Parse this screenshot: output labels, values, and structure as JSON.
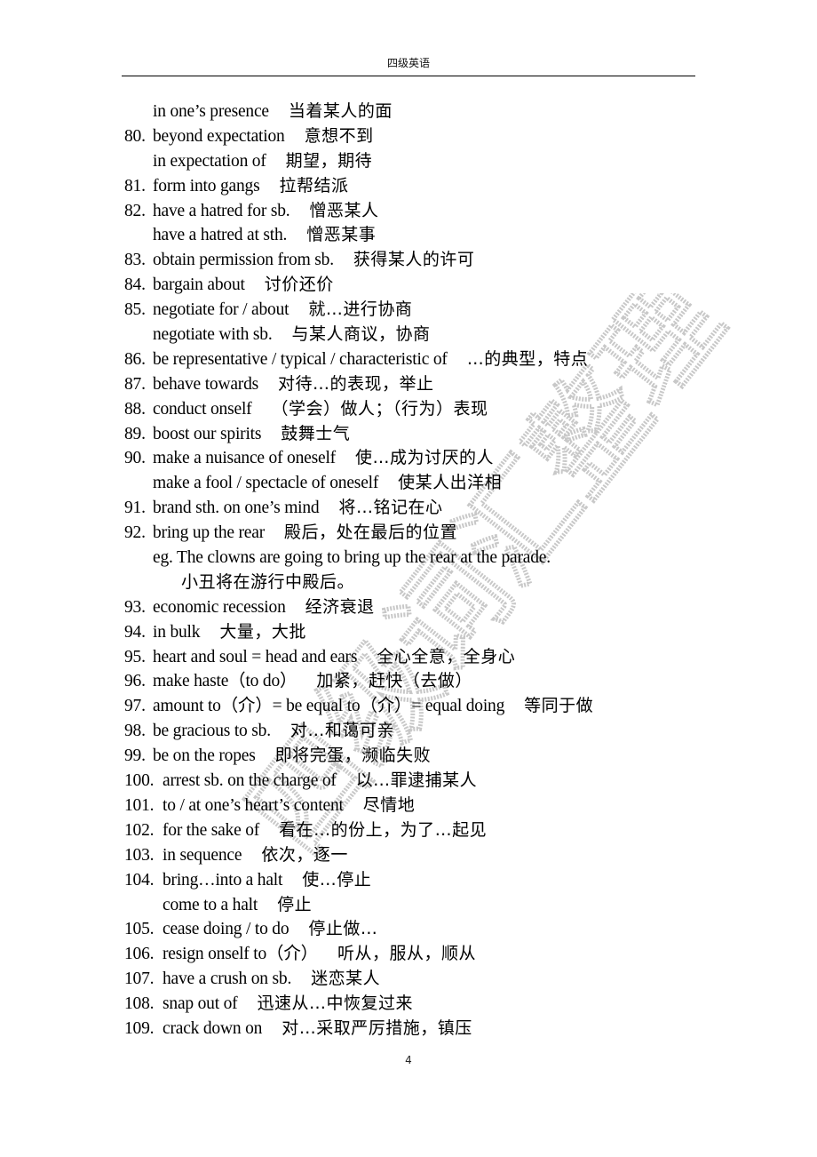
{
  "header": {
    "title": "四级英语"
  },
  "watermark": {
    "text": "四级词汇整理"
  },
  "entries": [
    {
      "num": "",
      "en": "in one’s presence",
      "zh": "当着某人的面",
      "level": "sub"
    },
    {
      "num": "80.",
      "en": "beyond expectation",
      "zh": "意想不到",
      "level": "main"
    },
    {
      "num": "",
      "en": "in expectation of",
      "zh": "期望，期待",
      "level": "sub"
    },
    {
      "num": "81.",
      "en": "form into gangs",
      "zh": "拉帮结派",
      "level": "main"
    },
    {
      "num": "82.",
      "en": "have a hatred for sb.",
      "zh": "憎恶某人",
      "level": "main"
    },
    {
      "num": "",
      "en": "have a hatred at sth.",
      "zh": "憎恶某事",
      "level": "sub"
    },
    {
      "num": "83.",
      "en": "obtain permission from sb.",
      "zh": "获得某人的许可",
      "level": "main"
    },
    {
      "num": "84.",
      "en": "bargain about",
      "zh": "讨价还价",
      "level": "main"
    },
    {
      "num": "85.",
      "en": "negotiate for / about",
      "zh": "就…进行协商",
      "level": "main"
    },
    {
      "num": "",
      "en": "negotiate with sb.",
      "zh": "与某人商议，协商",
      "level": "sub"
    },
    {
      "num": "86.",
      "en": "be representative / typical / characteristic of",
      "zh": "…的典型，特点",
      "level": "main"
    },
    {
      "num": "87.",
      "en": "behave towards",
      "zh": "对待…的表现，举止",
      "level": "main"
    },
    {
      "num": "88.",
      "en": "conduct onself",
      "zh": "（学会）做人；（行为）表现",
      "level": "main"
    },
    {
      "num": "89.",
      "en": "boost our spirits",
      "zh": "鼓舞士气",
      "level": "main"
    },
    {
      "num": "90.",
      "en": "make a nuisance of oneself",
      "zh": "使…成为讨厌的人",
      "level": "main"
    },
    {
      "num": "",
      "en": "make a fool / spectacle of oneself",
      "zh": "使某人出洋相",
      "level": "sub"
    },
    {
      "num": "91.",
      "en": "brand sth. on one’s mind",
      "zh": "将…铭记在心",
      "level": "main"
    },
    {
      "num": "92.",
      "en": "bring up the rear",
      "zh": "殿后，处在最后的位置",
      "level": "main"
    },
    {
      "num": "",
      "en": "eg. The clowns are going to bring up the rear at the parade.",
      "zh": "",
      "level": "sub"
    },
    {
      "num": "",
      "en": "",
      "zh": "小丑将在游行中殿后。",
      "level": "deep"
    },
    {
      "num": "93.",
      "en": "economic recession",
      "zh": "经济衰退",
      "level": "main"
    },
    {
      "num": "94.",
      "en": "in bulk",
      "zh": "大量，大批",
      "level": "main"
    },
    {
      "num": "95.",
      "en": "heart and soul = head and ears",
      "zh": "全心全意，全身心",
      "level": "main"
    },
    {
      "num": "96.",
      "en": "make haste（to do）",
      "zh": "加紧，赶快（去做）",
      "level": "main"
    },
    {
      "num": "97.",
      "en": "amount to（介）= be equal to（介）= equal doing",
      "zh": "等同于做",
      "level": "main"
    },
    {
      "num": "98.",
      "en": "be gracious to sb.",
      "zh": "对…和蔼可亲",
      "level": "main"
    },
    {
      "num": "99.",
      "en": "be on the ropes",
      "zh": "即将完蛋，濒临失败",
      "level": "main"
    },
    {
      "num": "100.",
      "en": "arrest sb. on the charge of",
      "zh": "以…罪逮捕某人",
      "level": "main"
    },
    {
      "num": "101.",
      "en": "to / at one’s heart’s content",
      "zh": "尽情地",
      "level": "main"
    },
    {
      "num": "102.",
      "en": "for the sake of",
      "zh": "看在…的份上，为了…起见",
      "level": "main"
    },
    {
      "num": "103.",
      "en": "in sequence",
      "zh": "依次，逐一",
      "level": "main"
    },
    {
      "num": "104.",
      "en": "bring…into a halt",
      "zh": "使…停止",
      "level": "main"
    },
    {
      "num": "",
      "en": "come to a halt",
      "zh": "停止",
      "level": "subwide"
    },
    {
      "num": "105.",
      "en": "cease doing / to do",
      "zh": "停止做…",
      "level": "main"
    },
    {
      "num": "106.",
      "en": "resign onself to（介）",
      "zh": "听从，服从，顺从",
      "level": "main"
    },
    {
      "num": "107.",
      "en": "have a crush on sb.",
      "zh": "迷恋某人",
      "level": "main"
    },
    {
      "num": "108.",
      "en": "snap out of",
      "zh": "迅速从…中恢复过来",
      "level": "main"
    },
    {
      "num": "109.",
      "en": "crack down on",
      "zh": "对…采取严厉措施，镇压",
      "level": "main"
    }
  ],
  "footer": {
    "page_number": "4"
  }
}
